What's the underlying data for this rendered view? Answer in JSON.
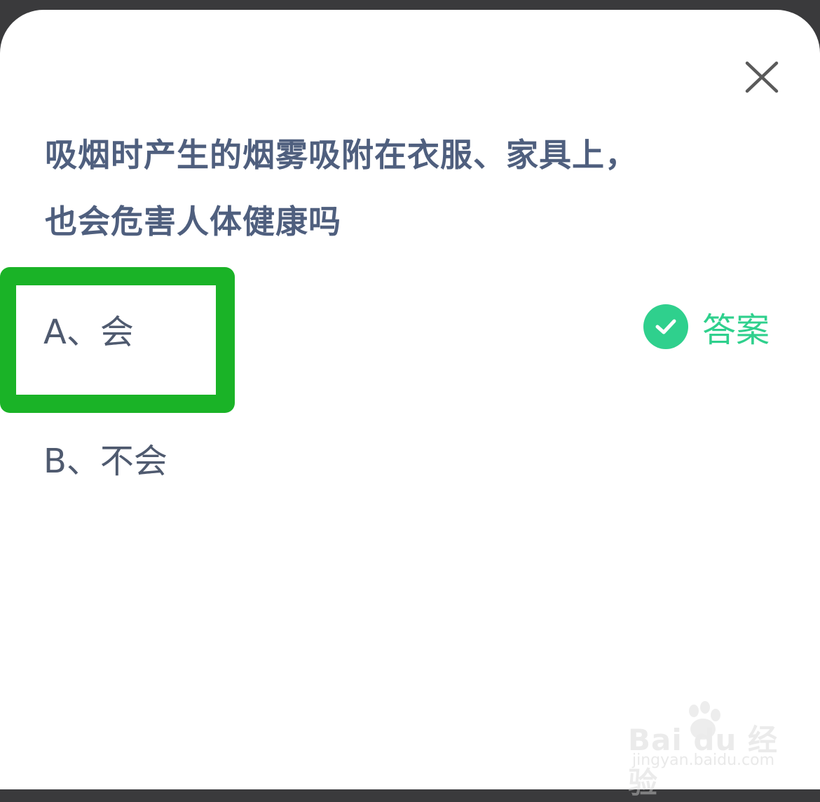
{
  "dialog": {
    "close_icon": "close-icon",
    "question_line1": "吸烟时产生的烟雾吸附在衣服、家具上，",
    "question_line2": "也会危害人体健康吗",
    "options": [
      {
        "label": "A、会",
        "selected": true
      },
      {
        "label": "B、不会",
        "selected": false
      }
    ],
    "answer": {
      "label": "答案",
      "icon": "check-circle-icon",
      "color": "#2fd08d"
    },
    "highlight_color": "#1ab327"
  },
  "watermark": {
    "logo_text": "Bai du 经验",
    "url": "jingyan.baidu.com"
  }
}
